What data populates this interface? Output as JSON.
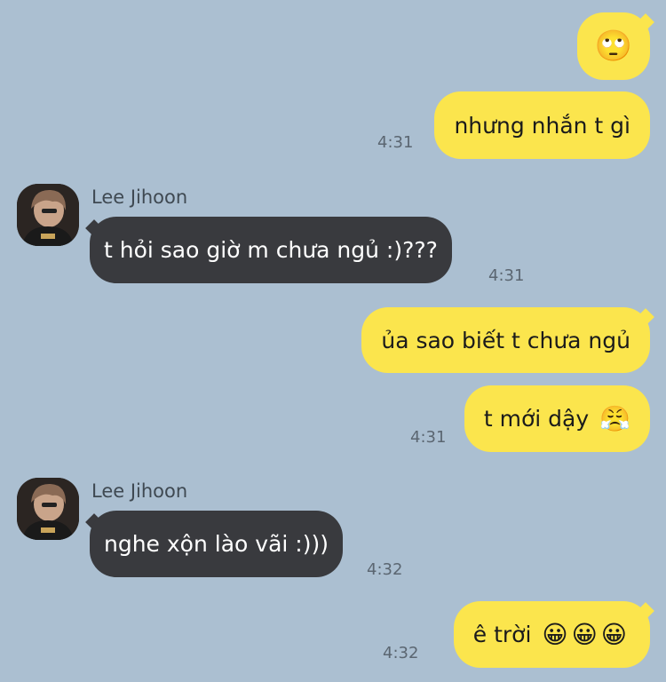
{
  "chat": {
    "messages": [
      {
        "id": "m1",
        "direction": "outgoing",
        "text": "",
        "emoji": "🙄",
        "time": ""
      },
      {
        "id": "m2",
        "direction": "outgoing",
        "text": "nhưng nhắn t gì",
        "time": "4:31"
      },
      {
        "id": "m3",
        "direction": "incoming",
        "sender": "Lee Jihoon",
        "text": "t hỏi sao giờ m chưa ngủ :)???",
        "time": "4:31"
      },
      {
        "id": "m4",
        "direction": "outgoing",
        "text": "ủa sao biết t chưa ngủ",
        "time": ""
      },
      {
        "id": "m5",
        "direction": "outgoing",
        "text": "t mới dậy",
        "emoji": "😤",
        "time": "4:31"
      },
      {
        "id": "m6",
        "direction": "incoming",
        "sender": "Lee Jihoon",
        "text": "nghe xộn lào vãi :)))",
        "time": "4:32"
      },
      {
        "id": "m7",
        "direction": "outgoing",
        "text": "ê trời",
        "emoji": "😀😀😀",
        "time": "4:32"
      }
    ]
  },
  "colors": {
    "background": "#abbfd1",
    "outgoing_bubble": "#fbe54d",
    "incoming_bubble": "#393a3e"
  }
}
